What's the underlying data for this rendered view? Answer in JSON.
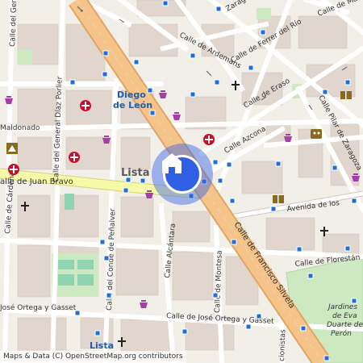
{
  "map": {
    "streets": {
      "zaragoza": "Zaragoza",
      "maria": "Calle de María",
      "ardemans": "Calle de Ardemans",
      "ferrer": "Calle de Ferrer del Río",
      "erasso": "Calle de Eraso",
      "azcona": "Calle Azcona",
      "pilar_zaragoza": "Calle Pilar de Zaragoza",
      "avenida_los": "Avenida de los",
      "maldonado": "Maldonado",
      "diaz_porlier": "Calle del General Díaz Porlier",
      "general_left": "Calle del General",
      "juan_bravo": "alle de Juan Bravo",
      "conde_penalver": "Calle del Conde de Peñalver",
      "alcantara": "Calle Alcántara",
      "montesa": "Calle de Montesa",
      "francisco_silvela": "Calle de Francisco Silvela",
      "florestan": "Calle de Florestán",
      "ortega_left": "José Ortega y Gasset",
      "ortega_right": "Calle de José Ortega y Gasset",
      "cioccionistas": "cionistas",
      "cardenas": "Calle de Cárdenas"
    },
    "places": {
      "diego_de_leon": [
        "Diego",
        "de León"
      ],
      "lista_metro": "Lista",
      "lista_area": "Lista",
      "jardines": [
        "Jardines",
        "de Eva",
        "Duarte de",
        "Perón"
      ]
    },
    "marker": {
      "icon": "home-icon",
      "color": "#2f5fe3"
    },
    "attribution": "Maps & Data (C) OpenStreetMap.org contributors",
    "colors": {
      "background": "#f2efe9",
      "main_road": "#f4c48a",
      "secondary_road": "#f6f9a8",
      "minor_road": "#ffffff",
      "park": "#c9e8c0",
      "building": "#d9d0c9",
      "metro_text": "#1f5ea8",
      "hospital": "#c8102e",
      "shop": "#a53ea8",
      "stop": "#1e6fd9"
    }
  }
}
